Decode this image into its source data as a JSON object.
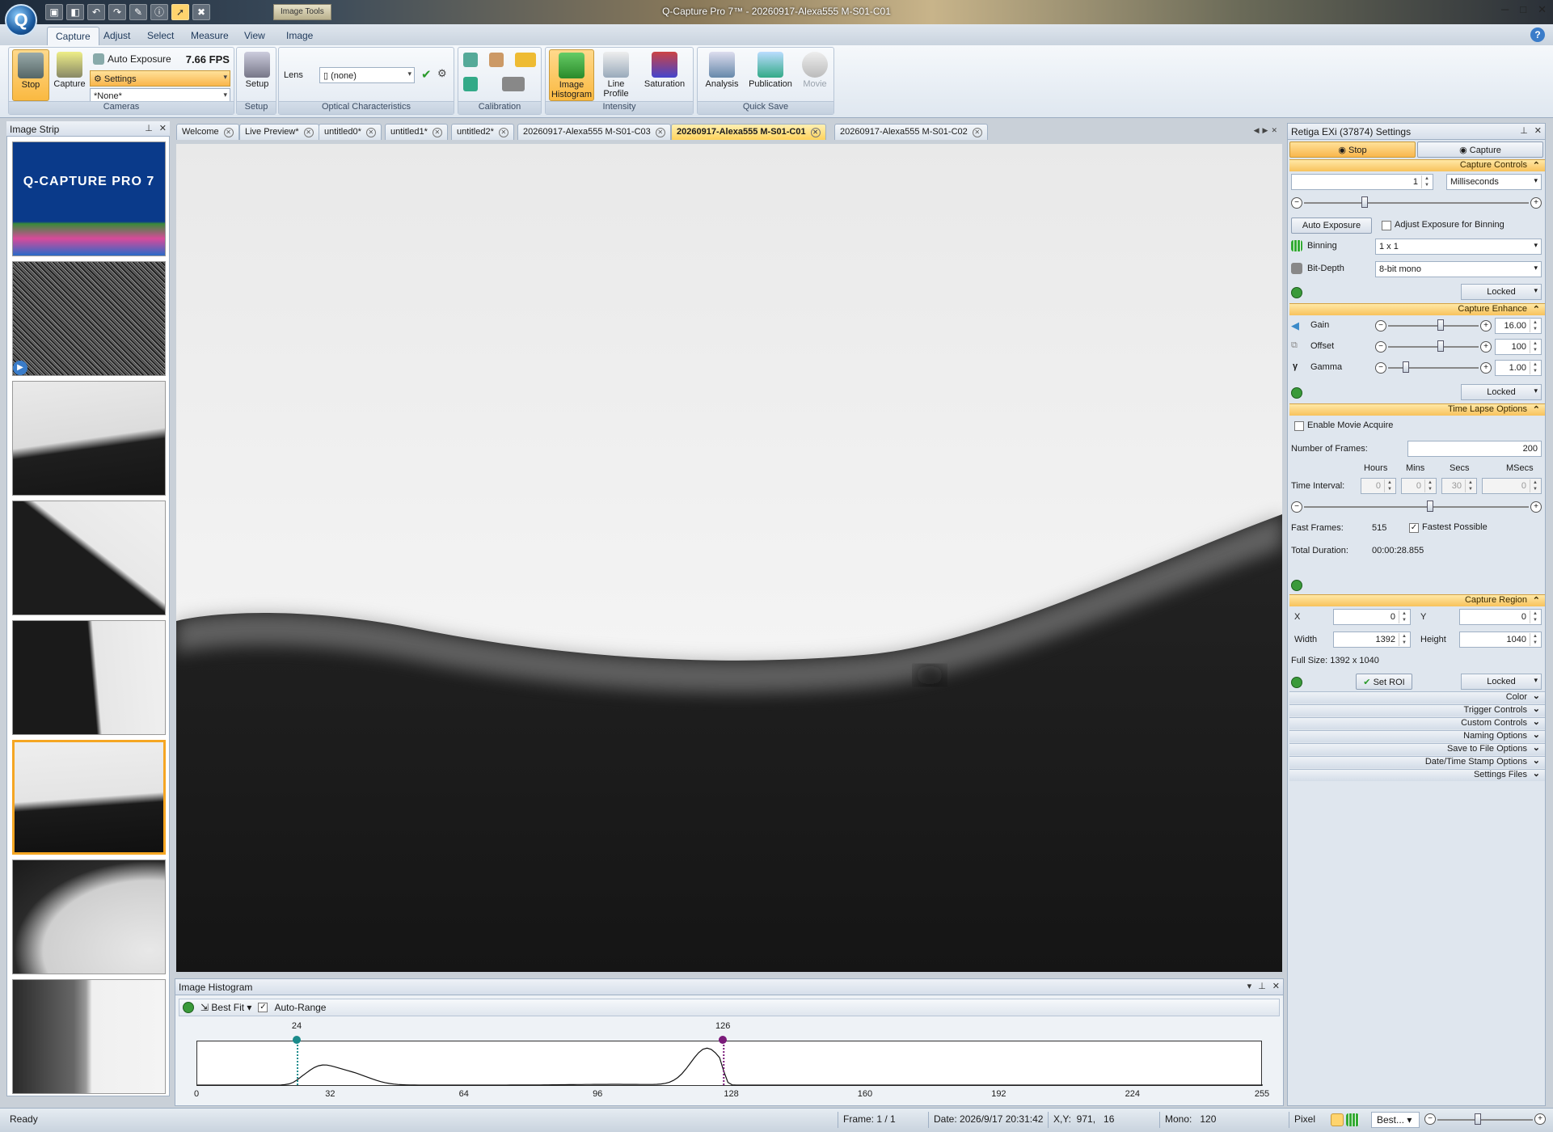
{
  "window": {
    "title": "Q-Capture Pro 7™ - 20260917-Alexa555 M-S01-C01",
    "context_tab": "Image Tools",
    "orb_label": "Q",
    "controls": [
      "─",
      "□",
      "✕"
    ]
  },
  "quick_access": [
    "disk-icon",
    "camera-icon",
    "undo-icon",
    "redo-icon",
    "tool-icon",
    "info-icon",
    "pointer-icon",
    "delete-icon"
  ],
  "ribbon_tabs": [
    "Capture",
    "Adjust",
    "Select",
    "Measure",
    "View",
    "Image"
  ],
  "active_ribbon_tab": "Capture",
  "ribbon": {
    "cameras": {
      "stop": "Stop",
      "capture": "Capture",
      "auto_exposure": "Auto Exposure",
      "fps": "7.66 FPS",
      "settings": "Settings",
      "preset": "*None*",
      "label": "Cameras"
    },
    "setup": {
      "button": "Setup",
      "label": "Setup"
    },
    "optical": {
      "lens_label": "Lens",
      "lens_value": "(none)",
      "label": "Optical Characteristics"
    },
    "calibration": {
      "label": "Calibration"
    },
    "intensity": {
      "image_histogram": "Image Histogram",
      "line_profile": "Line Profile",
      "saturation": "Saturation",
      "label": "Intensity"
    },
    "quick_save": {
      "analysis": "Analysis",
      "publication": "Publication",
      "movie": "Movie",
      "label": "Quick Save"
    }
  },
  "image_strip": {
    "title": "Image Strip",
    "logo_text": "Q-CAPTURE PRO 7"
  },
  "doc_tabs": [
    "Welcome",
    "Live Preview*",
    "untitled0*",
    "untitled1*",
    "untitled2*",
    "20260917-Alexa555 M-S01-C03",
    "20260917-Alexa555 M-S01-C01",
    "20260917-Alexa555 M-S01-C02"
  ],
  "active_doc_tab": "20260917-Alexa555 M-S01-C01",
  "histogram": {
    "title": "Image Histogram",
    "fit": "Best Fit",
    "auto_range": "Auto-Range",
    "auto_range_checked": true,
    "low_marker": 24,
    "high_marker": 126,
    "x_ticks": [
      "0",
      "32",
      "64",
      "96",
      "128",
      "160",
      "192",
      "224",
      "255"
    ],
    "x_range": [
      0,
      255
    ],
    "low_color": "#1a8a8a",
    "high_color": "#7a1a7a"
  },
  "settings": {
    "title": "Retiga EXi (37874) Settings",
    "stop_tab": "Stop",
    "capture_tab": "Capture",
    "capture_controls": {
      "header": "Capture Controls",
      "exposure_value": "1",
      "exposure_unit": "Milliseconds",
      "exposure_slider_fraction": 0.27,
      "auto_exposure": "Auto Exposure",
      "adjust_binning": "Adjust Exposure for Binning",
      "binning_label": "Binning",
      "binning_value": "1 x 1",
      "bitdepth_label": "Bit-Depth",
      "bitdepth_value": "8-bit mono",
      "locked": "Locked"
    },
    "capture_enhance": {
      "header": "Capture Enhance",
      "gain_label": "Gain",
      "gain_value": "16.00",
      "gain_fraction": 0.58,
      "offset_label": "Offset",
      "offset_value": "100",
      "offset_fraction": 0.58,
      "gamma_label": "Gamma",
      "gamma_value": "1.00",
      "gamma_fraction": 0.2,
      "locked": "Locked"
    },
    "time_lapse": {
      "header": "Time Lapse Options",
      "enable_movie": "Enable Movie Acquire",
      "frames_label": "Number of Frames:",
      "frames_value": "200",
      "hours_label": "Hours",
      "mins_label": "Mins",
      "secs_label": "Secs",
      "msecs_label": "MSecs",
      "interval_label": "Time Interval:",
      "hours_value": "0",
      "mins_value": "0",
      "secs_value": "30",
      "msecs_value": "0",
      "interval_fraction": 0.56,
      "fast_frames_label": "Fast Frames:",
      "fast_frames_value": "515",
      "fastest_possible": "Fastest Possible",
      "total_duration_label": "Total Duration:",
      "total_duration_value": "00:00:28.855"
    },
    "capture_region": {
      "header": "Capture Region",
      "x_label": "X",
      "x_value": "0",
      "y_label": "Y",
      "y_value": "0",
      "width_label": "Width",
      "width_value": "1392",
      "height_label": "Height",
      "height_value": "1040",
      "full_size": "Full Size: 1392 x 1040",
      "set_roi": "Set ROI",
      "locked": "Locked"
    },
    "collapsed_sections": [
      "Color",
      "Trigger Controls",
      "Custom Controls",
      "Naming Options",
      "Save to File Options",
      "Date/Time Stamp Options",
      "Settings Files"
    ]
  },
  "status": {
    "ready": "Ready",
    "frame": "Frame: 1 / 1",
    "date": "Date: 2026/9/17 20:31:42",
    "xy": "X,Y:  971,   16",
    "mono": "Mono:   120",
    "pixel": "Pixel",
    "zoom": "Best..."
  }
}
